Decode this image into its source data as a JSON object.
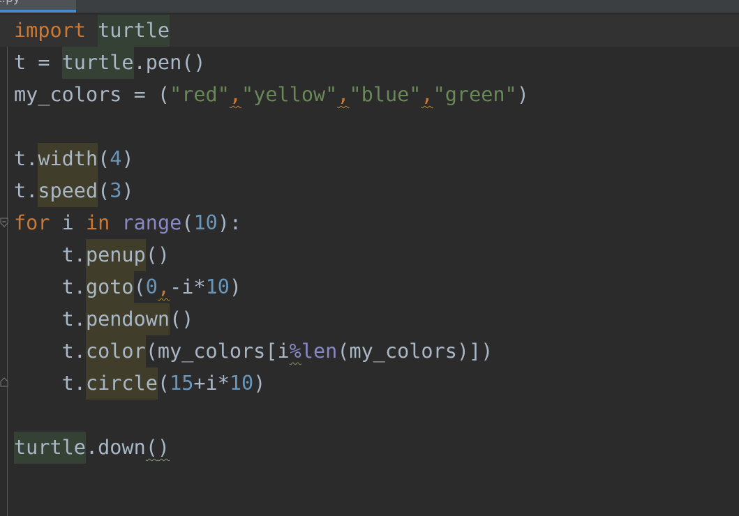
{
  "tab": {
    "label": "t.py"
  },
  "code": {
    "line1": {
      "a": "import",
      "b": " ",
      "c": "turtle"
    },
    "line2": {
      "a": "t = ",
      "b": "turtle",
      "c": ".pen()"
    },
    "line3": {
      "a": "my_colors = (",
      "b": "\"red\"",
      "c": ",",
      "d": "\"yellow\"",
      "e": ",",
      "f": "\"blue\"",
      "g": ",",
      "h": "\"green\"",
      "i": ")"
    },
    "line4": {},
    "line5": {
      "a": "t.",
      "b": "width",
      "c": "(",
      "d": "4",
      "e": ")"
    },
    "line6": {
      "a": "t.",
      "b": "speed",
      "c": "(",
      "d": "3",
      "e": ")"
    },
    "line7": {
      "a": "for",
      "b": " i ",
      "c": "in",
      "d": " ",
      "e": "range",
      "f": "(",
      "g": "10",
      "h": "):"
    },
    "line8": {
      "a": "    t.",
      "b": "penup",
      "c": "()"
    },
    "line9": {
      "a": "    t.",
      "b": "goto",
      "c": "(",
      "d": "0",
      "e": ",",
      "f": "-i*",
      "g": "10",
      "h": ")"
    },
    "line10": {
      "a": "    t.",
      "b": "pendown",
      "c": "()"
    },
    "line11": {
      "a": "    t.",
      "b": "color",
      "c": "(my_colors[i",
      "d": "%",
      "e": "len",
      "f": "(my_colors)])"
    },
    "line12": {
      "a": "    t.",
      "b": "circle",
      "c": "(",
      "d": "15",
      "e": "+i*",
      "f": "10",
      "g": ")"
    },
    "line13": {},
    "line14": {
      "a": "turtle",
      "b": ".down",
      "c": "(",
      "d": ")"
    }
  },
  "colors": {
    "background": "#2b2b2b",
    "keyword": "#cc7832",
    "string": "#6a8759",
    "number": "#6897bb",
    "builtin": "#8888c6",
    "text": "#a9b7c6"
  }
}
